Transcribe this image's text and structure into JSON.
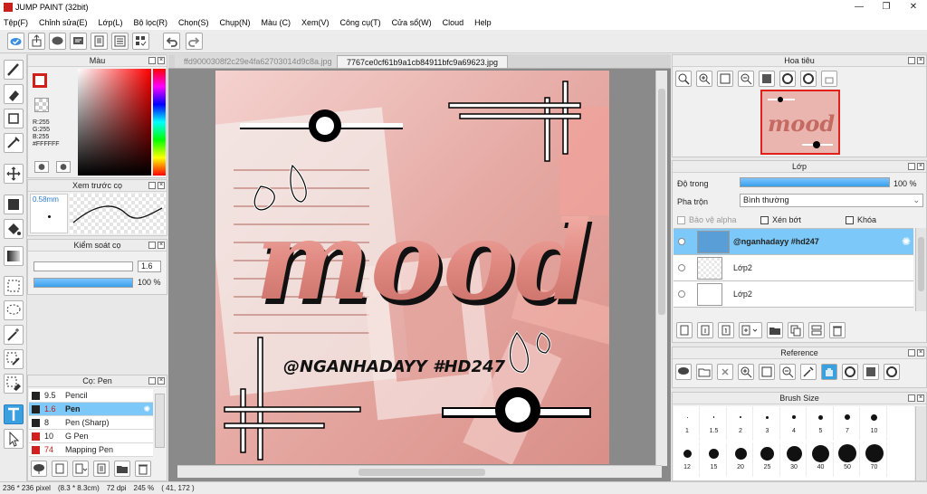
{
  "app": {
    "title": "JUMP PAINT (32bit)"
  },
  "menu": [
    "Tệp(F)",
    "Chỉnh sửa(E)",
    "Lớp(L)",
    "Bộ lọc(R)",
    "Chọn(S)",
    "Chụp(N)",
    "Màu (C)",
    "Xem(V)",
    "Công cụ(T)",
    "Cửa sổ(W)",
    "Cloud",
    "Help"
  ],
  "panels": {
    "color": {
      "title": "Màu",
      "r": "R:255",
      "g": "G:255",
      "b": "B:255",
      "hex": "#FFFFFF",
      "accent": "#d0201a"
    },
    "brush_preview": {
      "title": "Xem trước cọ",
      "size": "0.58mm"
    },
    "brush_control": {
      "title": "Kiểm soát cọ",
      "size_value": "1.6",
      "opacity_value": "100 %",
      "opacity": 1.0
    },
    "brush_list": {
      "title": "Cọ: Pen",
      "items": [
        {
          "size": "9.5",
          "name": "Pencil",
          "color": "#222222"
        },
        {
          "size": "1.6",
          "name": "Pen",
          "color": "#222222",
          "selected": true
        },
        {
          "size": "8",
          "name": "Pen (Sharp)",
          "color": "#222222"
        },
        {
          "size": "10",
          "name": "G Pen",
          "color": "#d02020"
        },
        {
          "size": "74",
          "name": "Mapping Pen",
          "color": "#d02020"
        }
      ]
    },
    "navigator": {
      "title": "Hoa tiêu"
    },
    "layer": {
      "title": "Lớp",
      "opacity_label": "Độ trong",
      "opacity_value": "100 %",
      "opacity": 1.0,
      "blend_label": "Pha trộn",
      "blend_value": "Bình thường",
      "protect_alpha": "Bảo vệ alpha",
      "clipping": "Xén bớt",
      "lock": "Khóa",
      "layers": [
        {
          "name": "@nganhadayy #hd247",
          "selected": true
        },
        {
          "name": "Lớp2"
        },
        {
          "name": "Lớp2"
        }
      ]
    },
    "reference": {
      "title": "Reference"
    },
    "brush_size": {
      "title": "Brush Size",
      "sizes": [
        "1",
        "1.5",
        "2",
        "3",
        "4",
        "5",
        "7",
        "10",
        "12",
        "15",
        "20",
        "25",
        "30",
        "40",
        "50",
        "70"
      ]
    }
  },
  "tabs": [
    {
      "label": "ffd9000308f2c29e4fa62703014d9c8a.jpg",
      "active": false
    },
    {
      "label": "7767ce0cf61b9a1cb84911bfc9a69623.jpg",
      "active": true
    }
  ],
  "canvas": {
    "art_text": "mood",
    "watermark": "@NGANHADAYY #HD247"
  },
  "status": {
    "size": "236 * 236 pixel",
    "physical": "(8.3 * 8.3cm)",
    "dpi": "72 dpi",
    "zoom": "245 %",
    "coords": "( 41, 172 )"
  }
}
